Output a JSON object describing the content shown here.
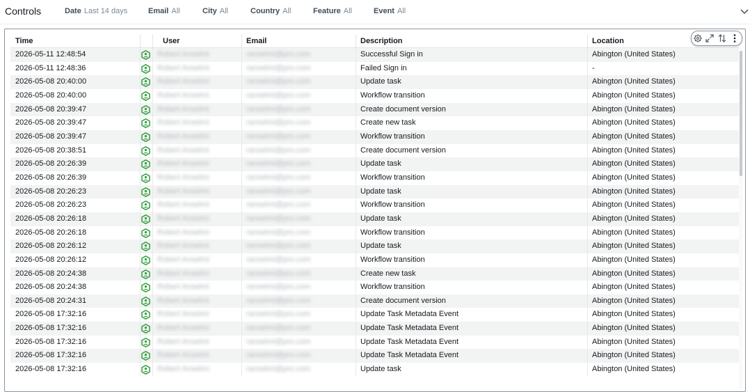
{
  "controls": {
    "title": "Controls",
    "filters": [
      {
        "label": "Date",
        "value": "Last 14 days"
      },
      {
        "label": "Email",
        "value": "All"
      },
      {
        "label": "City",
        "value": "All"
      },
      {
        "label": "Country",
        "value": "All"
      },
      {
        "label": "Feature",
        "value": "All"
      },
      {
        "label": "Event",
        "value": "All"
      }
    ]
  },
  "table": {
    "columns": [
      "Time",
      "",
      "User",
      "Email",
      "Description",
      "Location"
    ],
    "user_icon": "user-activity-icon",
    "rows": [
      {
        "time": "2026-05-11 12:48:54",
        "user": "Robert Anselmi",
        "email": "ranselmi@pro.com",
        "description": "Successful Sign in",
        "location": "Abington (United States)"
      },
      {
        "time": "2026-05-11 12:48:36",
        "user": "Robert Anselmi",
        "email": "ranselmi@pro.com",
        "description": "Failed Sign in",
        "location": "-"
      },
      {
        "time": "2026-05-08 20:40:00",
        "user": "Robert Anselmi",
        "email": "ranselmi@pro.com",
        "description": "Update task",
        "location": "Abington (United States)"
      },
      {
        "time": "2026-05-08 20:40:00",
        "user": "Robert Anselmi",
        "email": "ranselmi@pro.com",
        "description": "Workflow transition",
        "location": "Abington (United States)"
      },
      {
        "time": "2026-05-08 20:39:47",
        "user": "Robert Anselmi",
        "email": "ranselmi@pro.com",
        "description": "Create document version",
        "location": "Abington (United States)"
      },
      {
        "time": "2026-05-08 20:39:47",
        "user": "Robert Anselmi",
        "email": "ranselmi@pro.com",
        "description": "Create new task",
        "location": "Abington (United States)"
      },
      {
        "time": "2026-05-08 20:39:47",
        "user": "Robert Anselmi",
        "email": "ranselmi@pro.com",
        "description": "Workflow transition",
        "location": "Abington (United States)"
      },
      {
        "time": "2026-05-08 20:38:51",
        "user": "Robert Anselmi",
        "email": "ranselmi@pro.com",
        "description": "Create document version",
        "location": "Abington (United States)"
      },
      {
        "time": "2026-05-08 20:26:39",
        "user": "Robert Anselmi",
        "email": "ranselmi@pro.com",
        "description": "Update task",
        "location": "Abington (United States)"
      },
      {
        "time": "2026-05-08 20:26:39",
        "user": "Robert Anselmi",
        "email": "ranselmi@pro.com",
        "description": "Workflow transition",
        "location": "Abington (United States)"
      },
      {
        "time": "2026-05-08 20:26:23",
        "user": "Robert Anselmi",
        "email": "ranselmi@pro.com",
        "description": "Update task",
        "location": "Abington (United States)"
      },
      {
        "time": "2026-05-08 20:26:23",
        "user": "Robert Anselmi",
        "email": "ranselmi@pro.com",
        "description": "Workflow transition",
        "location": "Abington (United States)"
      },
      {
        "time": "2026-05-08 20:26:18",
        "user": "Robert Anselmi",
        "email": "ranselmi@pro.com",
        "description": "Update task",
        "location": "Abington (United States)"
      },
      {
        "time": "2026-05-08 20:26:18",
        "user": "Robert Anselmi",
        "email": "ranselmi@pro.com",
        "description": "Workflow transition",
        "location": "Abington (United States)"
      },
      {
        "time": "2026-05-08 20:26:12",
        "user": "Robert Anselmi",
        "email": "ranselmi@pro.com",
        "description": "Update task",
        "location": "Abington (United States)"
      },
      {
        "time": "2026-05-08 20:26:12",
        "user": "Robert Anselmi",
        "email": "ranselmi@pro.com",
        "description": "Workflow transition",
        "location": "Abington (United States)"
      },
      {
        "time": "2026-05-08 20:24:38",
        "user": "Robert Anselmi",
        "email": "ranselmi@pro.com",
        "description": "Create new task",
        "location": "Abington (United States)"
      },
      {
        "time": "2026-05-08 20:24:38",
        "user": "Robert Anselmi",
        "email": "ranselmi@pro.com",
        "description": "Workflow transition",
        "location": "Abington (United States)"
      },
      {
        "time": "2026-05-08 20:24:31",
        "user": "Robert Anselmi",
        "email": "ranselmi@pro.com",
        "description": "Create document version",
        "location": "Abington (United States)"
      },
      {
        "time": "2026-05-08 17:32:16",
        "user": "Robert Anselmi",
        "email": "ranselmi@pro.com",
        "description": "Update Task Metadata Event",
        "location": "Abington (United States)"
      },
      {
        "time": "2026-05-08 17:32:16",
        "user": "Robert Anselmi",
        "email": "ranselmi@pro.com",
        "description": "Update Task Metadata Event",
        "location": "Abington (United States)"
      },
      {
        "time": "2026-05-08 17:32:16",
        "user": "Robert Anselmi",
        "email": "ranselmi@pro.com",
        "description": "Update Task Metadata Event",
        "location": "Abington (United States)"
      },
      {
        "time": "2026-05-08 17:32:16",
        "user": "Robert Anselmi",
        "email": "ranselmi@pro.com",
        "description": "Update Task Metadata Event",
        "location": "Abington (United States)"
      },
      {
        "time": "2026-05-08 17:32:16",
        "user": "Robert Anselmi",
        "email": "ranselmi@pro.com",
        "description": "Update task",
        "location": "Abington (United States)"
      }
    ]
  },
  "toolbar": {
    "icons": [
      "settings-icon",
      "expand-icon",
      "sort-icon",
      "more-options-icon"
    ]
  },
  "colors": {
    "accent_green": "#3aa344",
    "row_stripe": "#f2f3f3",
    "header_text": "#16191f",
    "muted_text": "#7d8998"
  }
}
